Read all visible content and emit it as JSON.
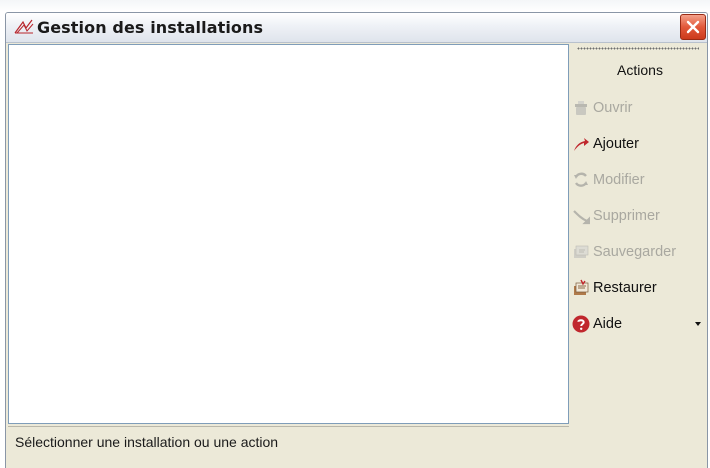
{
  "window": {
    "title": "Gestion des installations"
  },
  "actions": {
    "title": "Actions",
    "items": [
      {
        "label": "Ouvrir",
        "icon": "open-icon",
        "enabled": false
      },
      {
        "label": "Ajouter",
        "icon": "add-arrow-icon",
        "enabled": true
      },
      {
        "label": "Modifier",
        "icon": "modify-icon",
        "enabled": false
      },
      {
        "label": "Supprimer",
        "icon": "delete-icon",
        "enabled": false
      },
      {
        "label": "Sauvegarder",
        "icon": "backup-icon",
        "enabled": false
      },
      {
        "label": "Restaurer",
        "icon": "restore-icon",
        "enabled": true
      },
      {
        "label": "Aide",
        "icon": "help-icon",
        "enabled": true,
        "has_dropdown": true
      }
    ]
  },
  "status": {
    "text": "Sélectionner une installation ou une action"
  },
  "colors": {
    "close_button": "#e2583a",
    "help_icon": "#c0272d",
    "add_arrow": "#c0272d",
    "disabled_text": "#a9a8a0"
  }
}
